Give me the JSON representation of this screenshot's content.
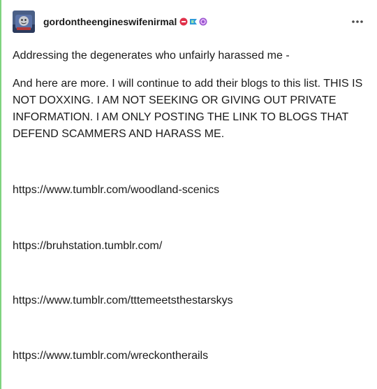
{
  "post": {
    "blog_name": "gordontheengineswifenirmal",
    "badges": [
      {
        "icon": "red-badge-icon",
        "color": "#e0314a"
      },
      {
        "icon": "blue-badge-icon",
        "color": "#2f9bd8"
      },
      {
        "icon": "purple-badge-icon",
        "color": "#9b59d0"
      }
    ],
    "more_options_icon": "ellipsis-icon",
    "paragraphs": [
      "Addressing the degenerates who unfairly harassed me -",
      "And here are more. I will continue to add their blogs to this list. THIS IS NOT DOXXING. I AM NOT SEEKING OR GIVING OUT PRIVATE INFORMATION. I AM ONLY POSTING THE LINK TO BLOGS THAT DEFEND SCAMMERS AND HARASS ME."
    ],
    "links": [
      "https://www.tumblr.com/woodland-scenics",
      "https://bruhstation.tumblr.com/",
      "https://www.tumblr.com/tttemeetsthestarskys",
      "https://www.tumblr.com/wreckontherails"
    ]
  },
  "colors": {
    "accent_rule": "#7fd37f",
    "text": "#1a1a1a"
  }
}
